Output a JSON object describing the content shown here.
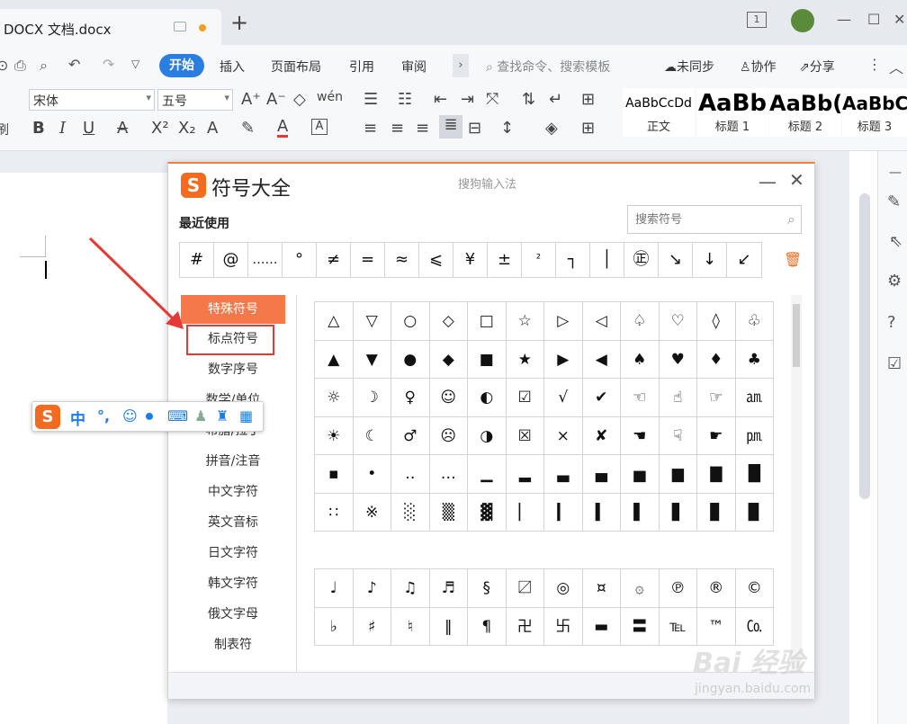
{
  "titlebar": {
    "doc_title": "DOCX 文档.docx",
    "new_tab": "+",
    "page_indicator": "1"
  },
  "tabs": {
    "home": "开始",
    "items": [
      "插入",
      "页面布局",
      "引用",
      "审阅"
    ],
    "search": "查找命令、搜索模板",
    "sync": "未同步",
    "collab": "协作",
    "share": "分享"
  },
  "ribbon": {
    "font_name": "宋体",
    "font_size": "五号",
    "clip_label": "刷",
    "styles": [
      {
        "preview": "AaBbCcDd",
        "name": "正文"
      },
      {
        "preview": "AaBb",
        "name": "标题 1"
      },
      {
        "preview": "AaBb(",
        "name": "标题 2"
      },
      {
        "preview": "AaBbC",
        "name": "标题 3"
      }
    ]
  },
  "dialog": {
    "title": "符号大全",
    "subtitle": "搜狗输入法",
    "recent_label": "最近使用",
    "search_placeholder": "搜索符号",
    "recent": [
      "#",
      "@",
      "……",
      "°",
      "≠",
      "=",
      "≈",
      "⩽",
      "¥",
      "±",
      "²",
      "┐",
      "│",
      "㊣",
      "↘",
      "↓",
      "↙"
    ],
    "categories_active": "特殊符号",
    "categories": [
      "标点符号",
      "数字序号",
      "数学/单位",
      "希腊/拉丁",
      "拼音/注音",
      "中文字符",
      "英文音标",
      "日文字符",
      "韩文字符",
      "俄文字母",
      "制表符"
    ],
    "grid1": [
      "△",
      "▽",
      "○",
      "◇",
      "□",
      "☆",
      "▷",
      "◁",
      "♤",
      "♡",
      "◊",
      "♧",
      "▲",
      "▼",
      "●",
      "◆",
      "■",
      "★",
      "▶",
      "◀",
      "♠",
      "♥",
      "♦",
      "♣",
      "☼",
      "☽",
      "♀",
      "☺",
      "◐",
      "☑",
      "√",
      "✔",
      "☜",
      "☝",
      "☞",
      "㏂",
      "☀",
      "☾",
      "♂",
      "☹",
      "◑",
      "☒",
      "×",
      "✘",
      "☚",
      "☟",
      "☛",
      "㏘",
      "▪",
      "•",
      "‥",
      "…",
      "▁",
      "▂",
      "▃",
      "▄",
      "▅",
      "▆",
      "▇",
      "█",
      "∷",
      "※",
      "░",
      "▒",
      "▓",
      "▏",
      "▎",
      "▍",
      "▌",
      "▋",
      "▊",
      "▉"
    ],
    "grid2": [
      "♩",
      "♪",
      "♫",
      "♬",
      "§",
      "〼",
      "◎",
      "¤",
      "۞",
      "℗",
      "®",
      "©",
      "♭",
      "♯",
      "♮",
      "‖",
      "¶",
      "卍",
      "卐",
      "▬",
      "〓",
      "℡",
      "™",
      "㏇"
    ]
  },
  "ime": {
    "logo": "S",
    "mode": "中",
    "punct": "°,",
    "icons": [
      "☺",
      "🎤",
      "⌨",
      "👤",
      "👕",
      "▦"
    ]
  },
  "watermark": {
    "brand": "Bai 经验",
    "url": "jingyan.baidu.com"
  }
}
